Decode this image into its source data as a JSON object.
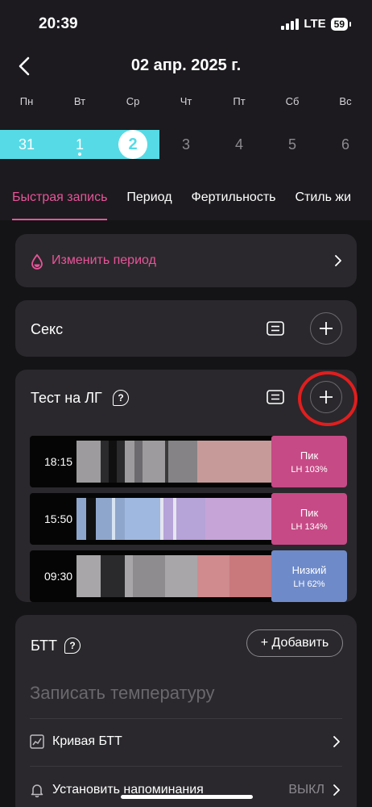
{
  "status": {
    "time": "20:39",
    "network": "LTE",
    "battery": "59"
  },
  "header": {
    "title": "02 апр. 2025 г."
  },
  "week": {
    "weekdays": [
      "Пн",
      "Вт",
      "Ср",
      "Чт",
      "Пт",
      "Сб",
      "Вс"
    ],
    "days": [
      "31",
      "1",
      "2",
      "3",
      "4",
      "5",
      "6"
    ],
    "selected_day": "2"
  },
  "tabs": [
    {
      "label": "Быстрая запись"
    },
    {
      "label": "Период"
    },
    {
      "label": "Фертильность"
    },
    {
      "label": "Стиль жи"
    }
  ],
  "period_card": {
    "label": "Изменить период",
    "icon": "drop-icon"
  },
  "sex_card": {
    "title": "Секс"
  },
  "lh_card": {
    "title": "Тест на ЛГ",
    "help": "?",
    "tests": [
      {
        "time": "18:15",
        "level": "Пик",
        "value": "LH 103%",
        "color": "#c64a86"
      },
      {
        "time": "15:50",
        "level": "Пик",
        "value": "LH 134%",
        "color": "#c64a86"
      },
      {
        "time": "09:30",
        "level": "Низкий",
        "value": "LH 62%",
        "color": "#6e8ac9"
      }
    ]
  },
  "btt_card": {
    "title": "БТТ",
    "help": "?",
    "add_label": "+ Добавить",
    "placeholder": "Записать температуру",
    "rows": [
      {
        "label": "Кривая БТТ",
        "value": ""
      },
      {
        "label": "Установить напоминания",
        "value": "ВЫКЛ"
      }
    ]
  },
  "colors": {
    "accent": "#e8549a",
    "range": "#56dbe6",
    "highlight_ring": "#e01e1e"
  }
}
